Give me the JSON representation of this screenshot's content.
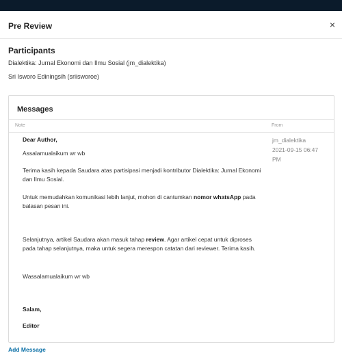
{
  "modal": {
    "title": "Pre Review",
    "close": "×"
  },
  "participants": {
    "heading": "Participants",
    "items": [
      "Dialektika: Jurnal Ekonomi dan Ilmu Sosial (jm_dialektika)",
      "Sri Isworo Ediningsih (sriisworoe)"
    ]
  },
  "messages": {
    "heading": "Messages",
    "columns": {
      "note": "Note",
      "from": "From"
    },
    "body": {
      "greeting": "Dear Author,",
      "salam_open": "Assalamualaikum wr wb",
      "p1": "Terima kasih kepada Saudara atas partisipasi menjadi kontributor Dialektika: Jurnal Ekonomi dan Ilmu Sosial.",
      "p2_before": "Untuk memudahkan komunikasi lebih lanjut, mohon di cantumkan ",
      "p2_bold": "nomor whatsApp",
      "p2_after": " pada balasan pesan ini.",
      "p3_before": "Selanjutnya, artikel Saudara akan masuk tahap ",
      "p3_bold": "review",
      "p3_after": ". Agar artikel cepat untuk diproses pada tahap selanjutnya, maka untuk  segera merespon catatan dari reviewer. Terima kasih.",
      "salam_close": "Wassalamualaikum wr wb",
      "signoff": "Salam,",
      "signature": "Editor"
    },
    "from": {
      "user": "jm_dialektika",
      "date": "2021-09-15 06:47",
      "time": "PM"
    }
  },
  "actions": {
    "add_message": "Add Message"
  }
}
